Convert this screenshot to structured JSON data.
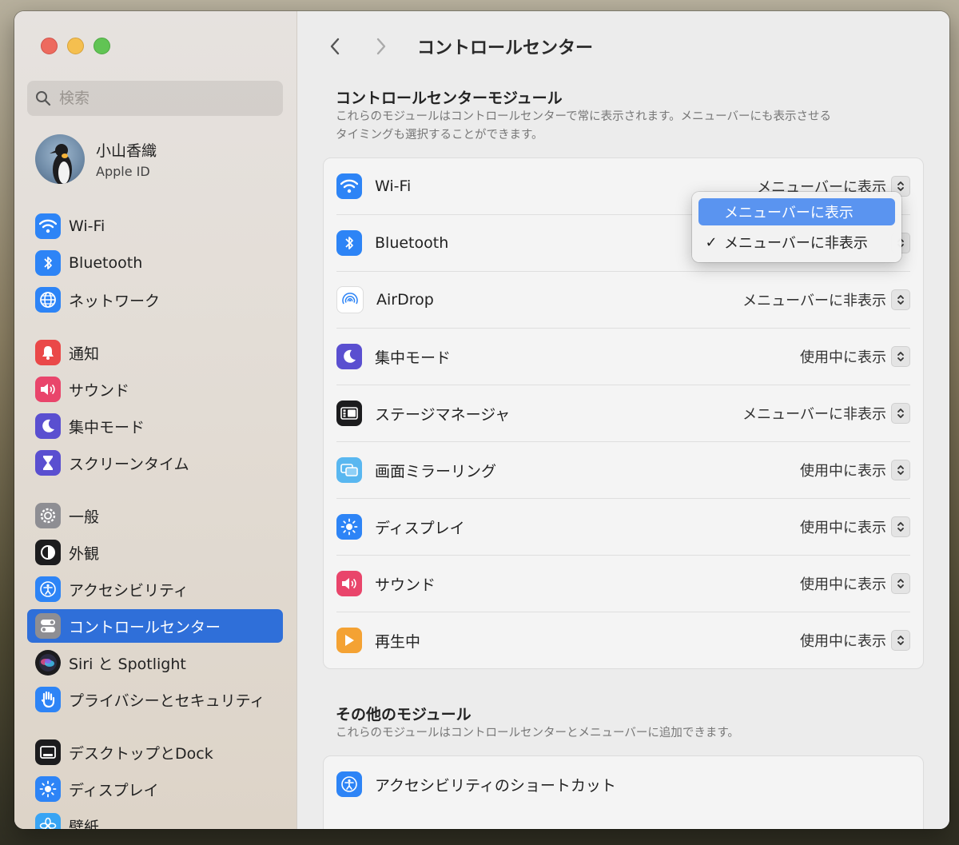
{
  "sidebar": {
    "search_placeholder": "検索",
    "profile": {
      "name": "小山香織",
      "sub": "Apple ID"
    },
    "items": [
      {
        "label": "Wi-Fi",
        "icon": "wifi-icon",
        "color": "#2d84f6"
      },
      {
        "label": "Bluetooth",
        "icon": "bluetooth-icon",
        "color": "#2d84f6"
      },
      {
        "label": "ネットワーク",
        "icon": "globe-icon",
        "color": "#2d84f6"
      },
      {
        "label": "通知",
        "icon": "bell-icon",
        "color": "#ea4848"
      },
      {
        "label": "サウンド",
        "icon": "speaker-icon",
        "color": "#e9456b"
      },
      {
        "label": "集中モード",
        "icon": "moon-icon",
        "color": "#5a4fd0"
      },
      {
        "label": "スクリーンタイム",
        "icon": "hourglass-icon",
        "color": "#5a4fd0"
      },
      {
        "label": "一般",
        "icon": "gear-icon",
        "color": "#8e8e93"
      },
      {
        "label": "外観",
        "icon": "appearance-icon",
        "color": "#1c1c1e"
      },
      {
        "label": "アクセシビリティ",
        "icon": "accessibility-icon",
        "color": "#2d84f6"
      },
      {
        "label": "コントロールセンター",
        "icon": "control-center-icon",
        "color": "#8e8e93"
      },
      {
        "label": "Siri と Spotlight",
        "icon": "siri-icon",
        "color": "#1c1c1e"
      },
      {
        "label": "プライバシーとセキュリティ",
        "icon": "hand-icon",
        "color": "#2d84f6"
      },
      {
        "label": "デスクトップとDock",
        "icon": "dock-icon",
        "color": "#1c1c1e"
      },
      {
        "label": "ディスプレイ",
        "icon": "display-icon",
        "color": "#2d84f6"
      },
      {
        "label": "壁紙",
        "icon": "wallpaper-icon",
        "color": "#38a4f4"
      }
    ]
  },
  "header": {
    "title": "コントロールセンター"
  },
  "modules": {
    "title": "コントロールセンターモジュール",
    "desc_1": "これらのモジュールはコントロールセンターで常に表示されます。メニューバーにも表示させる",
    "desc_2": "タイミングも選択することができます。",
    "rows": [
      {
        "label": "Wi-Fi",
        "value": "メニューバーに表示",
        "icon": "wifi-icon",
        "color": "#2d84f6"
      },
      {
        "label": "Bluetooth",
        "value": "",
        "icon": "bluetooth-icon",
        "color": "#2d84f6"
      },
      {
        "label": "AirDrop",
        "value": "メニューバーに非表示",
        "icon": "airdrop-icon",
        "color": "#ffffff"
      },
      {
        "label": "集中モード",
        "value": "使用中に表示",
        "icon": "moon-icon",
        "color": "#5a4fd0"
      },
      {
        "label": "ステージマネージャ",
        "value": "メニューバーに非表示",
        "icon": "stage-manager-icon",
        "color": "#1c1c1e"
      },
      {
        "label": "画面ミラーリング",
        "value": "使用中に表示",
        "icon": "screen-mirroring-icon",
        "color": "#59b7f0"
      },
      {
        "label": "ディスプレイ",
        "value": "使用中に表示",
        "icon": "display-icon",
        "color": "#2d84f6"
      },
      {
        "label": "サウンド",
        "value": "使用中に表示",
        "icon": "speaker-icon",
        "color": "#e9456b"
      },
      {
        "label": "再生中",
        "value": "使用中に表示",
        "icon": "play-icon",
        "color": "#f4a233"
      }
    ]
  },
  "popup": {
    "options": [
      "メニューバーに表示",
      "メニューバーに非表示"
    ],
    "checkmark": "✓"
  },
  "other": {
    "title": "その他のモジュール",
    "desc": "これらのモジュールはコントロールセンターとメニューバーに追加できます。",
    "rows": [
      {
        "label": "アクセシビリティのショートカット",
        "icon": "accessibility-icon",
        "color": "#2d84f6"
      }
    ]
  }
}
